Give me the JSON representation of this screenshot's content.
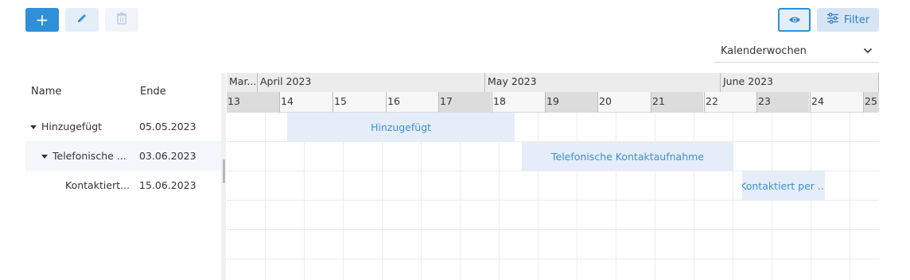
{
  "toolbar": {
    "add_label": "+",
    "add_icon": "plus-icon",
    "edit_icon": "pencil-icon",
    "delete_icon": "trash-icon",
    "view_icon": "eye-icon",
    "filter_icon": "sliders-icon",
    "filter_label": "Filter",
    "accent_color": "#2f8fd8"
  },
  "scale_select": {
    "value": "Kalenderwochen",
    "icon": "chevron-down-icon"
  },
  "grid": {
    "columns": [
      "Name",
      "Ende"
    ],
    "rows": [
      {
        "name": "Hinzugefügt",
        "end": "05.05.2023",
        "level": 0,
        "expanded": true
      },
      {
        "name": "Telefonische ...",
        "end": "03.06.2023",
        "level": 1,
        "expanded": true,
        "selected": true
      },
      {
        "name": "Kontaktiert...",
        "end": "15.06.2023",
        "level": 2
      }
    ]
  },
  "timeline": {
    "months": [
      "Mar...",
      "April 2023",
      "May 2023",
      "June 2023"
    ],
    "weeks": [
      "13",
      "14",
      "15",
      "16",
      "17",
      "18",
      "19",
      "20",
      "21",
      "22",
      "23",
      "24",
      "25"
    ],
    "tasks": [
      {
        "label": "Hinzugefügt"
      },
      {
        "label": "Telefonische Kontaktaufnahme"
      },
      {
        "label": "Kontaktiert per ..."
      }
    ],
    "bar_color": "#e5edf9",
    "bar_text_color": "#3c8fd0"
  }
}
